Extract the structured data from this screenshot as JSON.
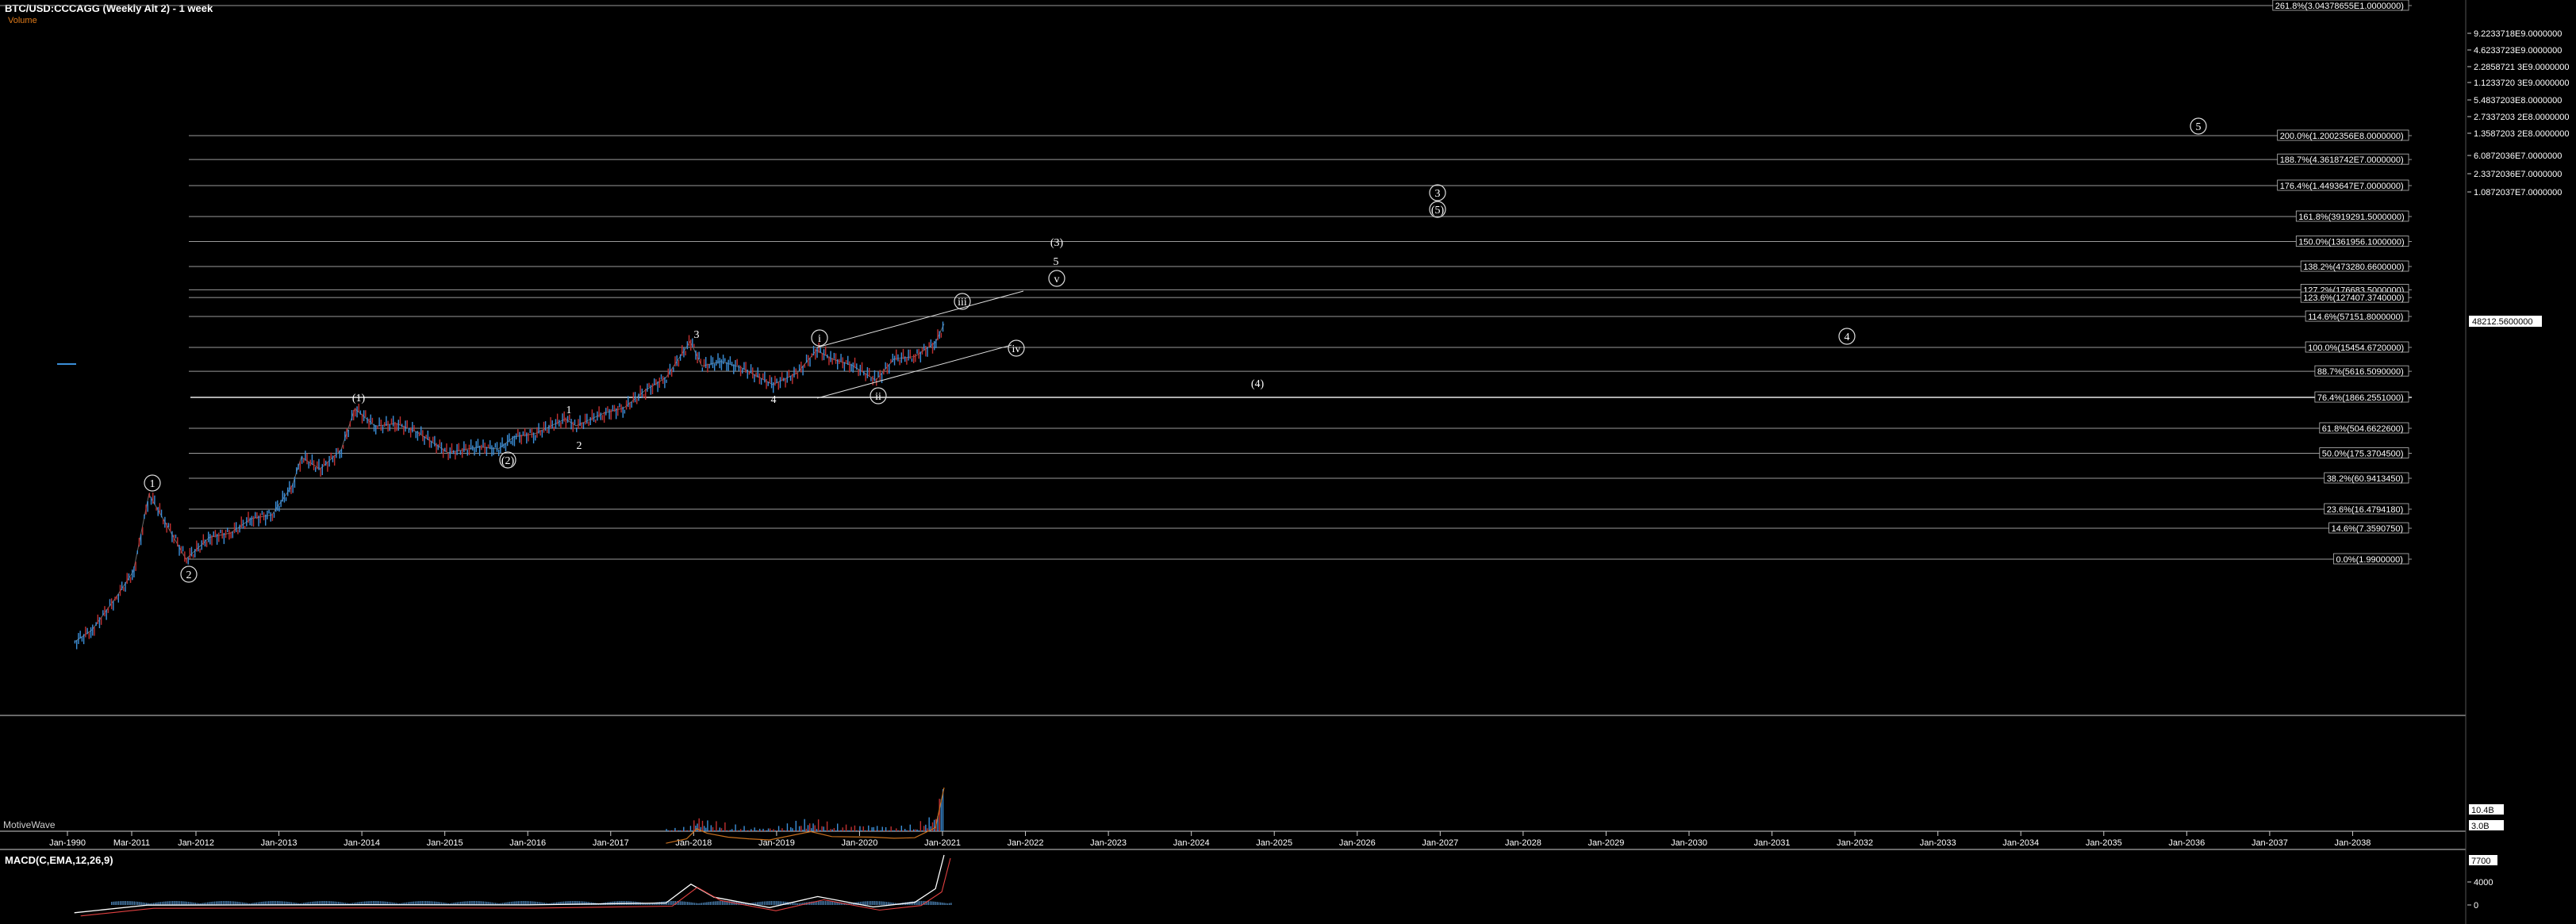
{
  "header": {
    "title": "BTC/USD:CCCAGG (Weekly Alt 2) - 1 week",
    "study": "Volume",
    "watermark": "MotiveWave",
    "macd_title": "MACD(C,EMA,12,26,9)"
  },
  "colors": {
    "background": "#000000",
    "up": "#3b8fd9",
    "down": "#c03030",
    "fib": "#9a9a9a",
    "macd": "#ffffff",
    "signal": "#e04040",
    "hist": "#4a7fb0",
    "volume_orange": "#c8701e"
  },
  "chart_data": [
    {
      "type": "line",
      "title": "BTC/USD:CCCAGG (Weekly Alt 2) - 1 week",
      "scale": "log",
      "y_range": [
        0.5,
        500000000000
      ],
      "x_range": [
        "2010-06-01",
        "2038-12-31"
      ],
      "x_ticks": [
        "Jan-1990",
        "Mar-2011",
        "Jan-2012",
        "Jan-2013",
        "Jan-2014",
        "Jan-2015",
        "Jan-2016",
        "Jan-2017",
        "Jan-2018",
        "Jan-2019",
        "Jan-2020",
        "Jan-2021",
        "Jan-2022",
        "Jan-2023",
        "Jan-2024",
        "Jan-2025",
        "Jan-2026",
        "Jan-2027",
        "Jan-2028",
        "Jan-2029",
        "Jan-2030",
        "Jan-2031",
        "Jan-2032",
        "Jan-2033",
        "Jan-2034",
        "Jan-2035",
        "Jan-2036",
        "Jan-2037",
        "Jan-2038"
      ],
      "y_tick_labels": [
        "9.2233718E9.0000000",
        "4.6233723E9.0000000",
        "2.2858721 3E9.0000000",
        "1.1233720 3E9.0000000",
        "5.4837203E8.0000000",
        "2.7337203 2E8.0000000",
        "1.3587203 2E8.0000000",
        "6.0872036E7.0000000",
        "2.3372036E7.0000000",
        "1.0872037E7.0000000"
      ],
      "current_price": "48212.5600000",
      "series": [
        {
          "x": [
            "2010-07-15",
            "2010-10-01",
            "2011-01-15",
            "2011-04-01",
            "2011-06-08",
            "2011-08-15",
            "2011-11-18",
            "2012-03-01",
            "2012-06-01",
            "2012-09-01",
            "2012-12-01",
            "2013-03-01",
            "2013-04-10",
            "2013-07-01",
            "2013-10-01",
            "2013-12-01",
            "2014-03-01",
            "2014-06-01",
            "2014-09-01",
            "2015-01-14",
            "2015-06-01",
            "2015-08-24",
            "2015-11-01",
            "2016-02-01",
            "2016-06-15",
            "2016-08-01",
            "2016-12-01",
            "2017-03-01",
            "2017-06-01",
            "2017-09-01",
            "2017-12-17",
            "2018-02-06",
            "2018-05-01",
            "2018-08-01",
            "2018-12-15",
            "2019-04-01",
            "2019-06-26",
            "2019-09-01",
            "2019-12-01",
            "2020-03-13",
            "2020-06-01",
            "2020-09-01",
            "2020-12-01",
            "2021-01-08"
          ],
          "values": [
            0.06,
            0.1,
            0.4,
            1.2,
            31,
            10,
            2,
            5,
            6,
            11,
            13,
            45,
            150,
            90,
            200,
            1150,
            550,
            620,
            430,
            180,
            230,
            210,
            350,
            400,
            750,
            560,
            950,
            1200,
            2500,
            4300,
            19800,
            7000,
            8500,
            6500,
            3200,
            5200,
            13800,
            9500,
            7200,
            3850,
            9500,
            10500,
            19000,
            41900
          ]
        }
      ],
      "fib_levels": [
        "261.8%(3.04378655E1.0000000)",
        "200.0%(1.2002356E8.0000000)",
        "188.7%(4.3618742E7.0000000)",
        "176.4%(1.4493647E7.0000000)",
        "161.8%(3919291.5000000)",
        "150.0%(1361956.1000000)",
        "138.2%(473280.6600000)",
        "127.2%(176683.5000000)",
        "123.6%(127407.3740000)",
        "114.6%(57151.8000000)",
        "100.0%(15454.6720000)",
        "88.7%(5616.5090000)",
        "76.4%(1866.2551000)",
        "61.8%(504.6622600)",
        "50.0%(175.3704500)",
        "38.2%(60.9413450)",
        "23.6%(16.4794180)",
        "14.6%(7.3590750)",
        "0.0%(1.9900000)"
      ],
      "wave_labels": [
        "1",
        "2",
        "(1)",
        "(2)",
        "1",
        "2",
        "3",
        "4",
        "i",
        "ii",
        "iii",
        "iv",
        "v",
        "5",
        "(3)",
        "(4)",
        "(5)",
        "3",
        "4",
        "5"
      ]
    },
    {
      "type": "bar",
      "title": "Volume",
      "y_tick_labels": [
        "10.4B",
        "3.0B"
      ],
      "series": [
        {
          "name": "Volume",
          "x": [
            "2017-09-01",
            "2017-12-01",
            "2018-01-15",
            "2018-03-01",
            "2018-06-01",
            "2018-09-01",
            "2018-12-01",
            "2019-06-01",
            "2019-09-01",
            "2020-03-01",
            "2020-06-01",
            "2020-09-01",
            "2020-12-01",
            "2021-01-08"
          ],
          "values": [
            0.4,
            1.2,
            3.0,
            2.2,
            1.5,
            1.2,
            1.0,
            2.5,
            1.6,
            1.5,
            1.3,
            1.4,
            3.2,
            10.4
          ]
        }
      ]
    },
    {
      "type": "line",
      "title": "MACD(C,EMA,12,26,9)",
      "y_tick_labels": [
        "7700",
        "4000",
        "0"
      ],
      "series": [
        {
          "name": "MACD",
          "x": [
            "2010-07-15",
            "2011-06-01",
            "2012-06-01",
            "2014-01-01",
            "2016-01-01",
            "2017-09-01",
            "2017-12-20",
            "2018-04-01",
            "2018-12-01",
            "2019-07-01",
            "2020-03-01",
            "2020-09-01",
            "2020-12-01",
            "2021-01-08"
          ],
          "values": [
            -1200,
            -30,
            0,
            40,
            10,
            300,
            3200,
            1200,
            -400,
            1300,
            -300,
            400,
            2500,
            7700
          ]
        }
      ]
    }
  ]
}
